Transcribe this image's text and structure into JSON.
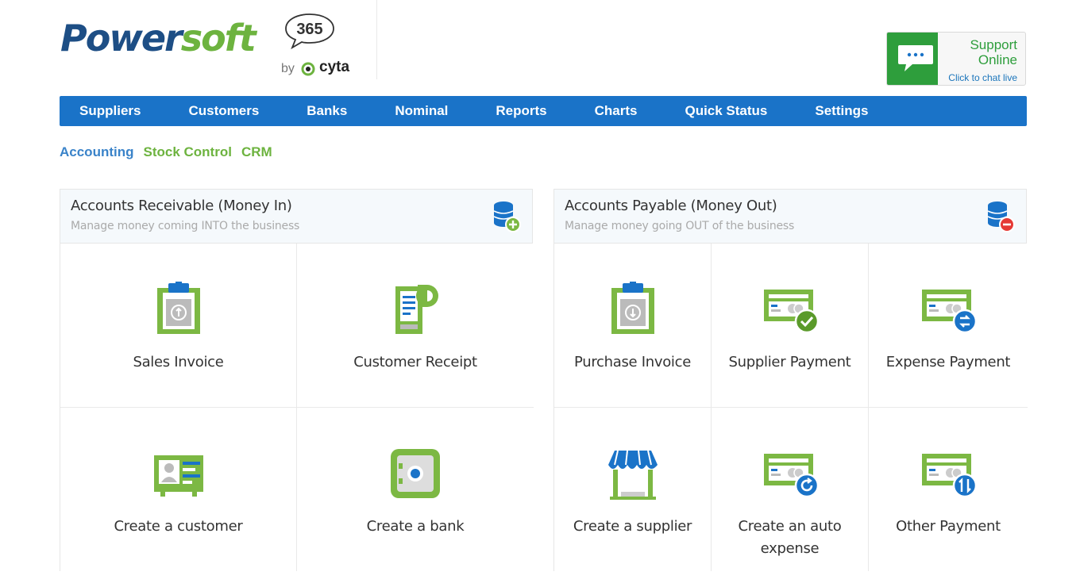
{
  "header": {
    "logo": {
      "word_part1": "Power",
      "word_part2": "soft",
      "badge": "365",
      "by": "by",
      "brand": "cyta"
    },
    "support": {
      "title_line1": "Support",
      "title_line2": "Online",
      "subtitle": "Click to chat live",
      "icon": "chat-bubble-icon"
    }
  },
  "nav": {
    "items": [
      "Suppliers",
      "Customers",
      "Banks",
      "Nominal",
      "Reports",
      "Charts",
      "Quick Status",
      "Settings"
    ]
  },
  "subnav": {
    "items": [
      "Accounting",
      "Stock Control",
      "CRM"
    ],
    "active": "Accounting"
  },
  "receivable": {
    "title": "Accounts Receivable (Money In)",
    "subtitle": "Manage money coming INTO the business",
    "icon": "database-add-icon",
    "tiles": [
      {
        "label": "Sales Invoice",
        "icon": "clipboard-invoice-icon"
      },
      {
        "label": "Customer Receipt",
        "icon": "receipt-icon"
      },
      {
        "label": "Create a customer",
        "icon": "customer-card-icon"
      },
      {
        "label": "Create a bank",
        "icon": "safe-icon"
      }
    ]
  },
  "payable": {
    "title": "Accounts Payable (Money Out)",
    "subtitle": "Manage money going OUT of the business",
    "icon": "database-remove-icon",
    "tiles": [
      {
        "label": "Purchase Invoice",
        "icon": "clipboard-invoice-icon"
      },
      {
        "label": "Supplier Payment",
        "icon": "payment-check-icon"
      },
      {
        "label": "Expense Payment",
        "icon": "payment-exchange-icon"
      },
      {
        "label": "Create a supplier",
        "icon": "storefront-icon"
      },
      {
        "label": "Create an auto expense",
        "icon": "payment-refresh-icon"
      },
      {
        "label": "Other Payment",
        "icon": "payment-transfer-icon"
      }
    ]
  },
  "colors": {
    "brand_blue": "#1d4e85",
    "nav_blue": "#1a73c8",
    "accent_green": "#6db33f",
    "icon_green": "#7cb843",
    "icon_blue": "#1a73c8",
    "remove_red": "#e53935"
  }
}
